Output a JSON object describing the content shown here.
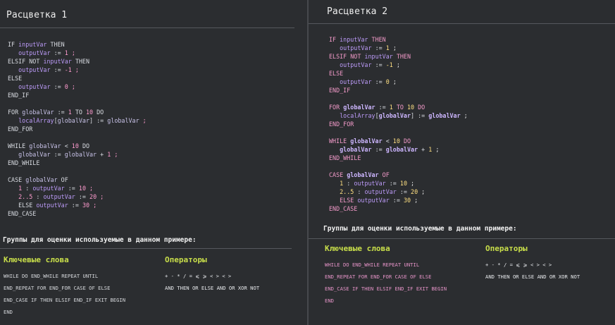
{
  "panels": {
    "left": {
      "title": "Расцветка 1",
      "groups_heading": "Группы для оценки используемые в данном примере:",
      "kw_title": "Ключевые слова",
      "op_title": "Операторы",
      "kw_lines": [
        "WHILE DO END_WHILE REPEAT UNTIL",
        "END_REPEAT FOR END_FOR CASE OF ELSE",
        "END_CASE IF THEN ELSIF END_IF EXIT BEGIN",
        "END"
      ],
      "op_lines": [
        "+  -  *  /  =  ⩽  ⩾  < >  <  >",
        "AND THEN  OR ELSE  AND  OR  XOR  NOT"
      ]
    },
    "right": {
      "title": "Расцветка 2",
      "groups_heading": "Группы для оценки используемые в данном примере:",
      "kw_title": "Ключевые слова",
      "op_title": "Операторы",
      "kw_lines": [
        "WHILE DO END_WHILE REPEAT UNTIL",
        "END_REPEAT FOR END_FOR CASE OF ELSE",
        "END_CASE IF THEN ELSIF END_IF EXIT BEGIN",
        "END"
      ],
      "op_lines": [
        "+  -  *  /  =  ⩽  ⩾  < >  <  >",
        "AND THEN  OR ELSE  AND  OR  XOR  NOT"
      ]
    }
  },
  "code": [
    [
      [
        "kw",
        "IF"
      ],
      [
        "p",
        " "
      ],
      [
        "tv",
        "inputVar"
      ],
      [
        "p",
        " "
      ],
      [
        "kw",
        "THEN"
      ]
    ],
    [
      [
        "p",
        "   "
      ],
      [
        "tv",
        "outputVar"
      ],
      [
        "p",
        " "
      ],
      [
        "op",
        ":="
      ],
      [
        "p",
        " "
      ],
      [
        "num",
        "1"
      ],
      [
        "p",
        " "
      ],
      [
        "semi",
        ";"
      ]
    ],
    [
      [
        "kw",
        "ELSIF NOT"
      ],
      [
        "p",
        " "
      ],
      [
        "tv",
        "inputVar"
      ],
      [
        "p",
        " "
      ],
      [
        "kw",
        "THEN"
      ]
    ],
    [
      [
        "p",
        "   "
      ],
      [
        "tv",
        "outputVar"
      ],
      [
        "p",
        " "
      ],
      [
        "op",
        ":="
      ],
      [
        "p",
        " "
      ],
      [
        "num",
        "-1"
      ],
      [
        "p",
        " "
      ],
      [
        "semi",
        ";"
      ]
    ],
    [
      [
        "kw",
        "ELSE"
      ]
    ],
    [
      [
        "p",
        "   "
      ],
      [
        "tv",
        "outputVar"
      ],
      [
        "p",
        " "
      ],
      [
        "op",
        ":="
      ],
      [
        "p",
        " "
      ],
      [
        "num",
        "0"
      ],
      [
        "p",
        " "
      ],
      [
        "semi",
        ";"
      ]
    ],
    [
      [
        "kw",
        "END_IF"
      ]
    ],
    [
      [
        "p",
        ""
      ]
    ],
    [
      [
        "kw",
        "FOR"
      ],
      [
        "p",
        " "
      ],
      [
        "fv",
        "globalVar"
      ],
      [
        "p",
        " "
      ],
      [
        "op",
        ":="
      ],
      [
        "p",
        " "
      ],
      [
        "num",
        "1"
      ],
      [
        "p",
        " "
      ],
      [
        "kw",
        "TO"
      ],
      [
        "p",
        " "
      ],
      [
        "num",
        "10"
      ],
      [
        "p",
        " "
      ],
      [
        "kw",
        "DO"
      ]
    ],
    [
      [
        "p",
        "   "
      ],
      [
        "tv",
        "localArray"
      ],
      [
        "op",
        "["
      ],
      [
        "fv",
        "globalVar"
      ],
      [
        "op",
        "]"
      ],
      [
        "p",
        " "
      ],
      [
        "op",
        ":="
      ],
      [
        "p",
        " "
      ],
      [
        "fv",
        "globalVar"
      ],
      [
        "p",
        " "
      ],
      [
        "semi",
        ";"
      ]
    ],
    [
      [
        "kw",
        "END_FOR"
      ]
    ],
    [
      [
        "p",
        ""
      ]
    ],
    [
      [
        "kw",
        "WHILE"
      ],
      [
        "p",
        " "
      ],
      [
        "fv",
        "globalVar"
      ],
      [
        "p",
        " "
      ],
      [
        "op",
        "<"
      ],
      [
        "p",
        " "
      ],
      [
        "num",
        "10"
      ],
      [
        "p",
        " "
      ],
      [
        "kw",
        "DO"
      ]
    ],
    [
      [
        "p",
        "   "
      ],
      [
        "fv",
        "globalVar"
      ],
      [
        "p",
        " "
      ],
      [
        "op",
        ":="
      ],
      [
        "p",
        " "
      ],
      [
        "fv",
        "globalVar"
      ],
      [
        "p",
        " "
      ],
      [
        "op",
        "+"
      ],
      [
        "p",
        " "
      ],
      [
        "num",
        "1"
      ],
      [
        "p",
        " "
      ],
      [
        "semi",
        ";"
      ]
    ],
    [
      [
        "kw",
        "END_WHILE"
      ]
    ],
    [
      [
        "p",
        ""
      ]
    ],
    [
      [
        "kw",
        "CASE"
      ],
      [
        "p",
        " "
      ],
      [
        "fv",
        "globalVar"
      ],
      [
        "p",
        " "
      ],
      [
        "kw",
        "OF"
      ]
    ],
    [
      [
        "p",
        "   "
      ],
      [
        "num",
        "1"
      ],
      [
        "p",
        " "
      ],
      [
        "op",
        ":"
      ],
      [
        "p",
        " "
      ],
      [
        "tv",
        "outputVar"
      ],
      [
        "p",
        " "
      ],
      [
        "op",
        ":="
      ],
      [
        "p",
        " "
      ],
      [
        "num",
        "10"
      ],
      [
        "p",
        " "
      ],
      [
        "semi",
        ";"
      ]
    ],
    [
      [
        "p",
        "   "
      ],
      [
        "num",
        "2..5"
      ],
      [
        "p",
        " "
      ],
      [
        "op",
        ":"
      ],
      [
        "p",
        " "
      ],
      [
        "tv",
        "outputVar"
      ],
      [
        "p",
        " "
      ],
      [
        "op",
        ":="
      ],
      [
        "p",
        " "
      ],
      [
        "num",
        "20"
      ],
      [
        "p",
        " "
      ],
      [
        "semi",
        ";"
      ]
    ],
    [
      [
        "p",
        "   "
      ],
      [
        "kw",
        "ELSE"
      ],
      [
        "p",
        " "
      ],
      [
        "tv",
        "outputVar"
      ],
      [
        "p",
        " "
      ],
      [
        "op",
        ":="
      ],
      [
        "p",
        " "
      ],
      [
        "num",
        "30"
      ],
      [
        "p",
        " "
      ],
      [
        "semi",
        ";"
      ]
    ],
    [
      [
        "kw",
        "END_CASE"
      ]
    ]
  ],
  "colors": {
    "left_keyword": "#d7dae0",
    "left_variable": "#bb9af7",
    "left_number": "#ff9ccf",
    "right_keyword": "#f29ac9",
    "right_variable": "#bb9af7",
    "right_number": "#ffe082",
    "accent_heading": "#c9df4a"
  }
}
